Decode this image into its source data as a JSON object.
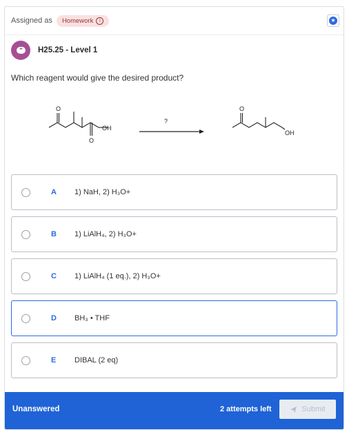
{
  "header": {
    "assigned_label": "Assigned as",
    "badge_label": "Homework",
    "info_icon": "info-icon",
    "star_icon": "star-icon"
  },
  "level": {
    "icon": "chat-bubble-icon",
    "title": "H25.25 - Level 1"
  },
  "question": {
    "text": "Which reagent would give the desired product?",
    "reaction_label": "?",
    "reactant_o1": "O",
    "reactant_o2": "O",
    "reactant_oh": "OH",
    "product_o": "O",
    "product_oh": "OH"
  },
  "choices": [
    {
      "letter": "A",
      "text": "1) NaH, 2) H₃O+",
      "selected": false
    },
    {
      "letter": "B",
      "text": "1) LiAlH₄, 2) H₃O+",
      "selected": false
    },
    {
      "letter": "C",
      "text": "1) LiAlH₄ (1 eq.), 2) H₃O+",
      "selected": false
    },
    {
      "letter": "D",
      "text": "BH₃ • THF",
      "selected": true
    },
    {
      "letter": "E",
      "text": "DIBAL (2 eq)",
      "selected": false
    }
  ],
  "footer": {
    "status": "Unanswered",
    "attempts": "2 attempts left",
    "submit_label": "Submit",
    "submit_icon": "paper-plane-icon"
  },
  "colors": {
    "accent": "#2c6be0",
    "footer_bg": "#1f63d6",
    "badge_bg": "#fbe0e0",
    "level_icon_bg": "#a64f94"
  }
}
